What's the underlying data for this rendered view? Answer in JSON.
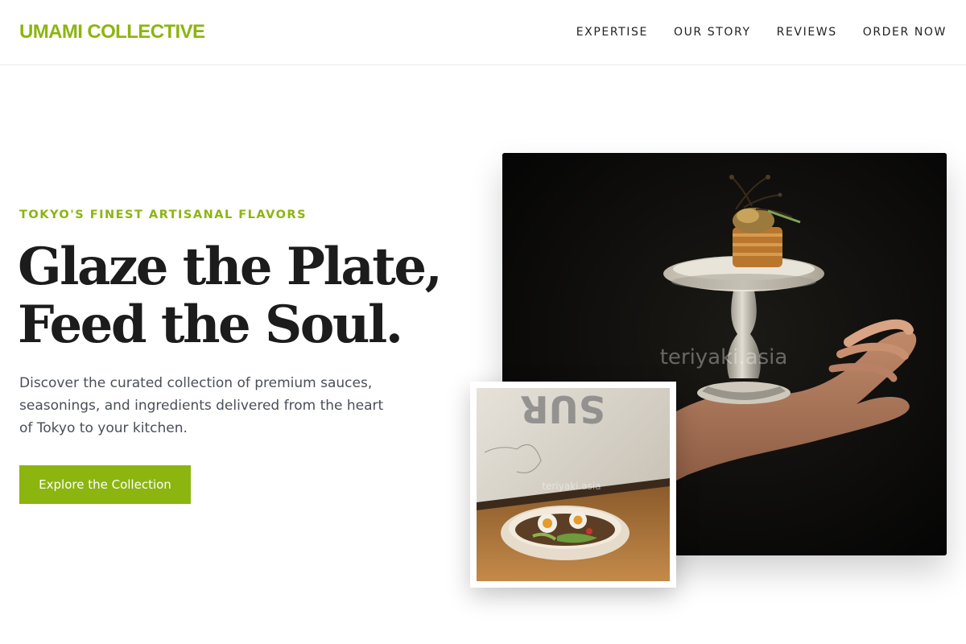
{
  "brand": {
    "name": "UMAMI COLLECTIVE",
    "accent_color": "#8cb50f"
  },
  "nav": {
    "items": [
      {
        "label": "EXPERTISE"
      },
      {
        "label": "OUR STORY"
      },
      {
        "label": "REVIEWS"
      },
      {
        "label": "ORDER NOW"
      }
    ]
  },
  "hero": {
    "eyebrow": "TOKYO'S FINEST ARTISANAL FLAVORS",
    "headline_line1": "Glaze the Plate,",
    "headline_line2": "Feed the Soul.",
    "description": "Discover the curated collection of premium sauces, seasonings, and ingredients delivered from the heart of Tokyo to your kitchen.",
    "cta_label": "Explore the Collection"
  },
  "images": {
    "main_photo": {
      "icon": "food-on-pedestal-photo",
      "watermark": "teriyaki.asia"
    },
    "inset_photo": {
      "icon": "bowl-on-counter-photo",
      "watermark": "teriyaki.asia",
      "window_text": "SUR"
    }
  }
}
